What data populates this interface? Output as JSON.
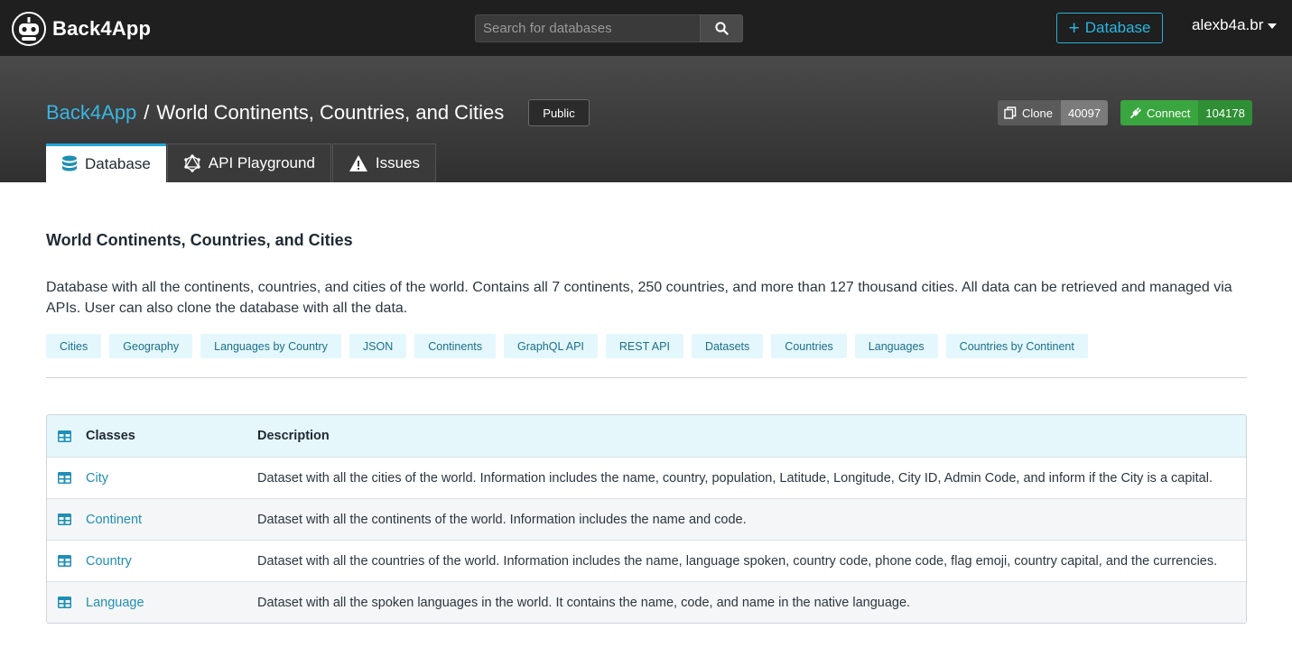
{
  "nav": {
    "brand": "Back4App",
    "search_placeholder": "Search for databases",
    "add_database_label": "Database",
    "user": "alexb4a.br"
  },
  "header": {
    "breadcrumb_root": "Back4App",
    "breadcrumb_separator": "/",
    "breadcrumb_current": "World Continents, Countries, and Cities",
    "visibility": "Public",
    "clone_label": "Clone",
    "clone_count": "40097",
    "connect_label": "Connect",
    "connect_count": "104178",
    "tabs": [
      {
        "label": "Database",
        "active": true
      },
      {
        "label": "API Playground",
        "active": false
      },
      {
        "label": "Issues",
        "active": false
      }
    ]
  },
  "main": {
    "title": "World Continents, Countries, and Cities",
    "description": "Database with all the continents, countries, and cities of the world. Contains all 7 continents, 250 countries, and more than 127 thousand cities. All data can be retrieved and managed via APIs. User can also clone the database with all the data.",
    "tags": [
      "Cities",
      "Geography",
      "Languages by Country",
      "JSON",
      "Continents",
      "GraphQL API",
      "REST API",
      "Datasets",
      "Countries",
      "Languages",
      "Countries by Continent"
    ],
    "table": {
      "headers": {
        "classes": "Classes",
        "description": "Description"
      },
      "rows": [
        {
          "name": "City",
          "description": "Dataset with all the cities of the world. Information includes the name, country, population, Latitude, Longitude, City ID, Admin Code, and inform if the City is a capital."
        },
        {
          "name": "Continent",
          "description": "Dataset with all the continents of the world. Information includes the name and code."
        },
        {
          "name": "Country",
          "description": "Dataset with all the countries of the world. Information includes the name, language spoken, country code, phone code, flag emoji, country capital, and the currencies."
        },
        {
          "name": "Language",
          "description": "Dataset with all the spoken languages in the world. It contains the name, code, and name in the native language."
        }
      ]
    }
  },
  "colors": {
    "accent": "#22a7d9",
    "nav_bg": "#1f1f1f",
    "connect_green": "#3aa63f",
    "tag_bg": "#e4f7fc"
  },
  "icons": {
    "logo": "back4app-robot-logo",
    "search": "search-icon",
    "database_tab": "database-icon",
    "api_tab": "graphql-icon",
    "issues_tab": "warning-icon",
    "table": "table-icon"
  }
}
